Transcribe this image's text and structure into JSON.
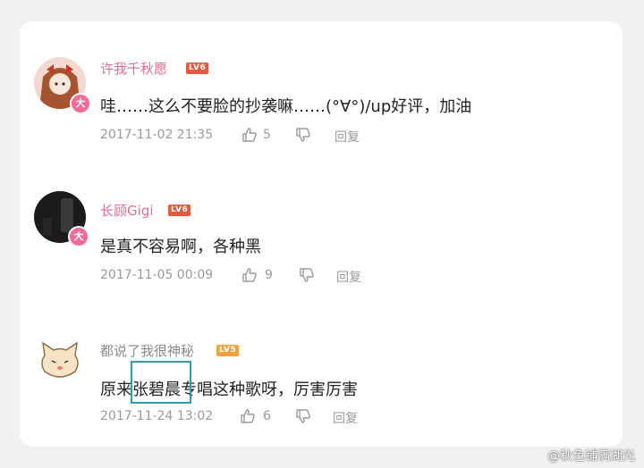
{
  "comments": [
    {
      "username": "许我千秋愿",
      "level": "LV6",
      "badge": "大",
      "text": "哇……这么不要脸的抄袭嘛……(°∀°)/up好评，加油",
      "time": "2017-11-02 21:35",
      "likes": "5",
      "reply": "回复"
    },
    {
      "username": "长顾Gigi",
      "level": "LV6",
      "badge": "大",
      "text": "是真不容易啊，各种黑",
      "time": "2017-11-05 00:09",
      "likes": "9",
      "reply": "回复"
    },
    {
      "username": "都说了我很神秘",
      "level": "LV5",
      "text": "原来张碧晨专唱这种歌呀，厉害厉害",
      "time": "2017-11-24 13:02",
      "likes": "6",
      "reply": "回复"
    }
  ],
  "watermark": "@秋色铺满湖光",
  "colors": {
    "username_pink": "#e36b8d",
    "level_red": "#e45a3f",
    "level_orange": "#f2a23c",
    "highlight": "#2a9fb4"
  }
}
